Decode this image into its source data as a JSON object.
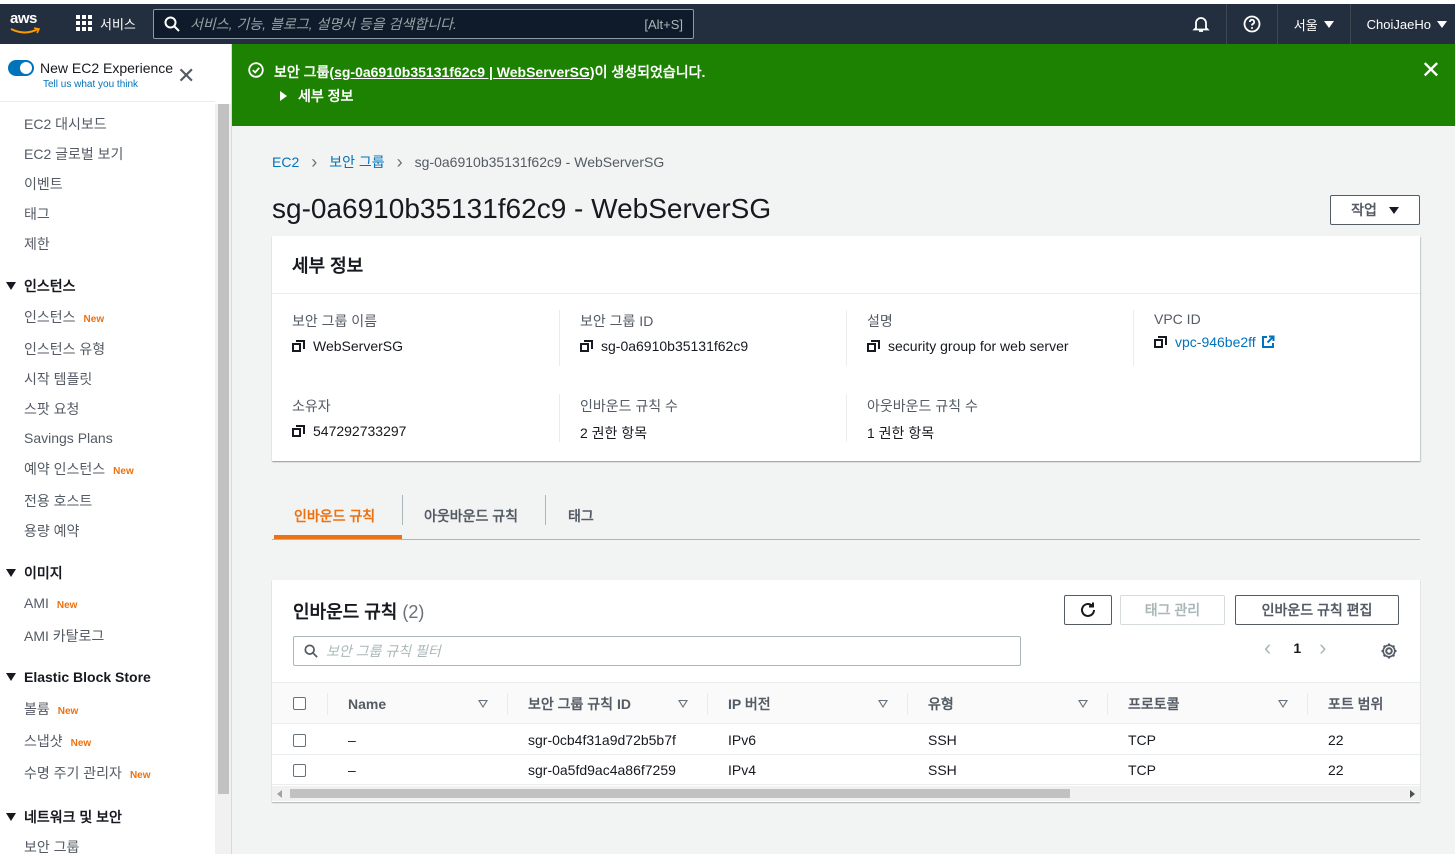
{
  "topbar": {
    "logo": "aws",
    "services_label": "서비스",
    "search_placeholder": "서비스, 기능, 블로그, 설명서 등을 검색합니다.",
    "search_shortcut": "[Alt+S]",
    "region": "서울",
    "user": "ChoiJaeHo",
    "icons": [
      "bell-icon",
      "help-icon"
    ]
  },
  "sidebar": {
    "toggle_label": "New EC2 Experience",
    "toggle_sub": "Tell us what you think",
    "new_badge": "New",
    "items": [
      {
        "label": "EC2 대시보드"
      },
      {
        "label": "EC2 글로벌 보기"
      },
      {
        "label": "이벤트"
      },
      {
        "label": "태그"
      },
      {
        "label": "제한"
      }
    ],
    "sections": [
      {
        "title": "인스턴스",
        "items": [
          "인스턴스",
          "인스턴스 유형",
          "시작 템플릿",
          "스팟 요청",
          "Savings Plans",
          "예약 인스턴스",
          "전용 호스트",
          "용량 예약"
        ]
      },
      {
        "title": "이미지",
        "items": [
          "AMI",
          "AMI 카탈로그"
        ]
      },
      {
        "title": "Elastic Block Store",
        "items": [
          "볼륨",
          "스냅샷",
          "수명 주기 관리자"
        ]
      },
      {
        "title": "네트워크 및 보안",
        "items": [
          "보안 그룹"
        ]
      }
    ]
  },
  "flash": {
    "prefix": "보안 그룹(",
    "link": "sg-0a6910b35131f62c9 | WebServerSG",
    "suffix": ")이 생성되었습니다.",
    "details": "세부 정보"
  },
  "breadcrumb": {
    "c1": "EC2",
    "c2": "보안 그룹",
    "c3": "sg-0a6910b35131f62c9 - WebServerSG"
  },
  "page": {
    "title": "sg-0a6910b35131f62c9 - WebServerSG",
    "action": "작업"
  },
  "details": {
    "header": "세부 정보",
    "sg_name_label": "보안 그룹 이름",
    "sg_name": "WebServerSG",
    "sg_id_label": "보안 그룹 ID",
    "sg_id": "sg-0a6910b35131f62c9",
    "desc_label": "설명",
    "desc": "security group for web server",
    "vpc_label": "VPC ID",
    "vpc": "vpc-946be2ff",
    "owner_label": "소유자",
    "owner": "547292733297",
    "inbound_label": "인바운드 규칙 수",
    "inbound": "2 권한 항목",
    "outbound_label": "아웃바운드 규칙 수",
    "outbound": "1 권한 항목"
  },
  "tabs": [
    "인바운드 규칙",
    "아웃바운드 규칙",
    "태그"
  ],
  "rules": {
    "title": "인바운드 규칙",
    "count": "(2)",
    "manage_tags": "태그 관리",
    "edit": "인바운드 규칙 편집",
    "filter_placeholder": "보안 그룹 규칙 필터",
    "page": "1",
    "columns": [
      "Name",
      "보안 그룹 규칙 ID",
      "IP 버전",
      "유형",
      "프로토콜",
      "포트 범위"
    ],
    "rows": [
      {
        "name": "–",
        "id": "sgr-0cb4f31a9d72b5b7f",
        "ip": "IPv6",
        "type": "SSH",
        "proto": "TCP",
        "port": "22"
      },
      {
        "name": "–",
        "id": "sgr-0a5fd9ac4a86f7259",
        "ip": "IPv4",
        "type": "SSH",
        "proto": "TCP",
        "port": "22"
      }
    ]
  },
  "colors": {
    "accent": "#ec7211",
    "success": "#1d8102",
    "link": "#0073bb",
    "nav": "#232f3e"
  }
}
